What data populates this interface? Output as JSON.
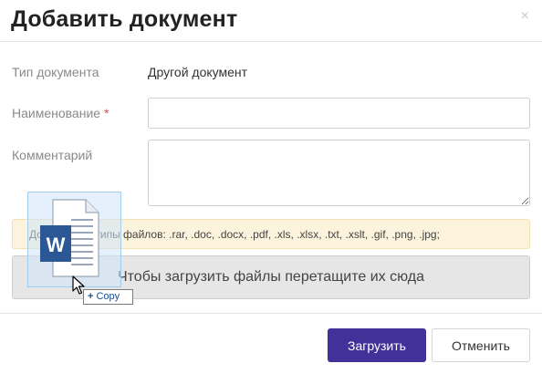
{
  "dialog": {
    "title": "Добавить документ",
    "close_glyph": "×"
  },
  "form": {
    "doc_type_label": "Тип документа",
    "doc_type_value": "Другой документ",
    "name_label": "Наименование",
    "required_mark": "*",
    "name_value": "",
    "comment_label": "Комментарий",
    "comment_value": ""
  },
  "alert": {
    "text": "Допустимые типы файлов: .rar, .doc, .docx, .pdf, .xls, .xlsx, .txt, .xslt, .gif, .png, .jpg;"
  },
  "dropzone": {
    "text": "Чтобы загрузить файлы перетащите их сюда"
  },
  "footer": {
    "upload_label": "Загрузить",
    "cancel_label": "Отменить"
  },
  "drag": {
    "file_icon": "word-document-icon",
    "badge_symbol": "+",
    "badge_label": "Copy"
  },
  "colors": {
    "primary": "#43319a",
    "alert_bg": "#fcf3dc",
    "dropzone_bg": "#e6e6e6",
    "word_blue": "#2b5797"
  }
}
